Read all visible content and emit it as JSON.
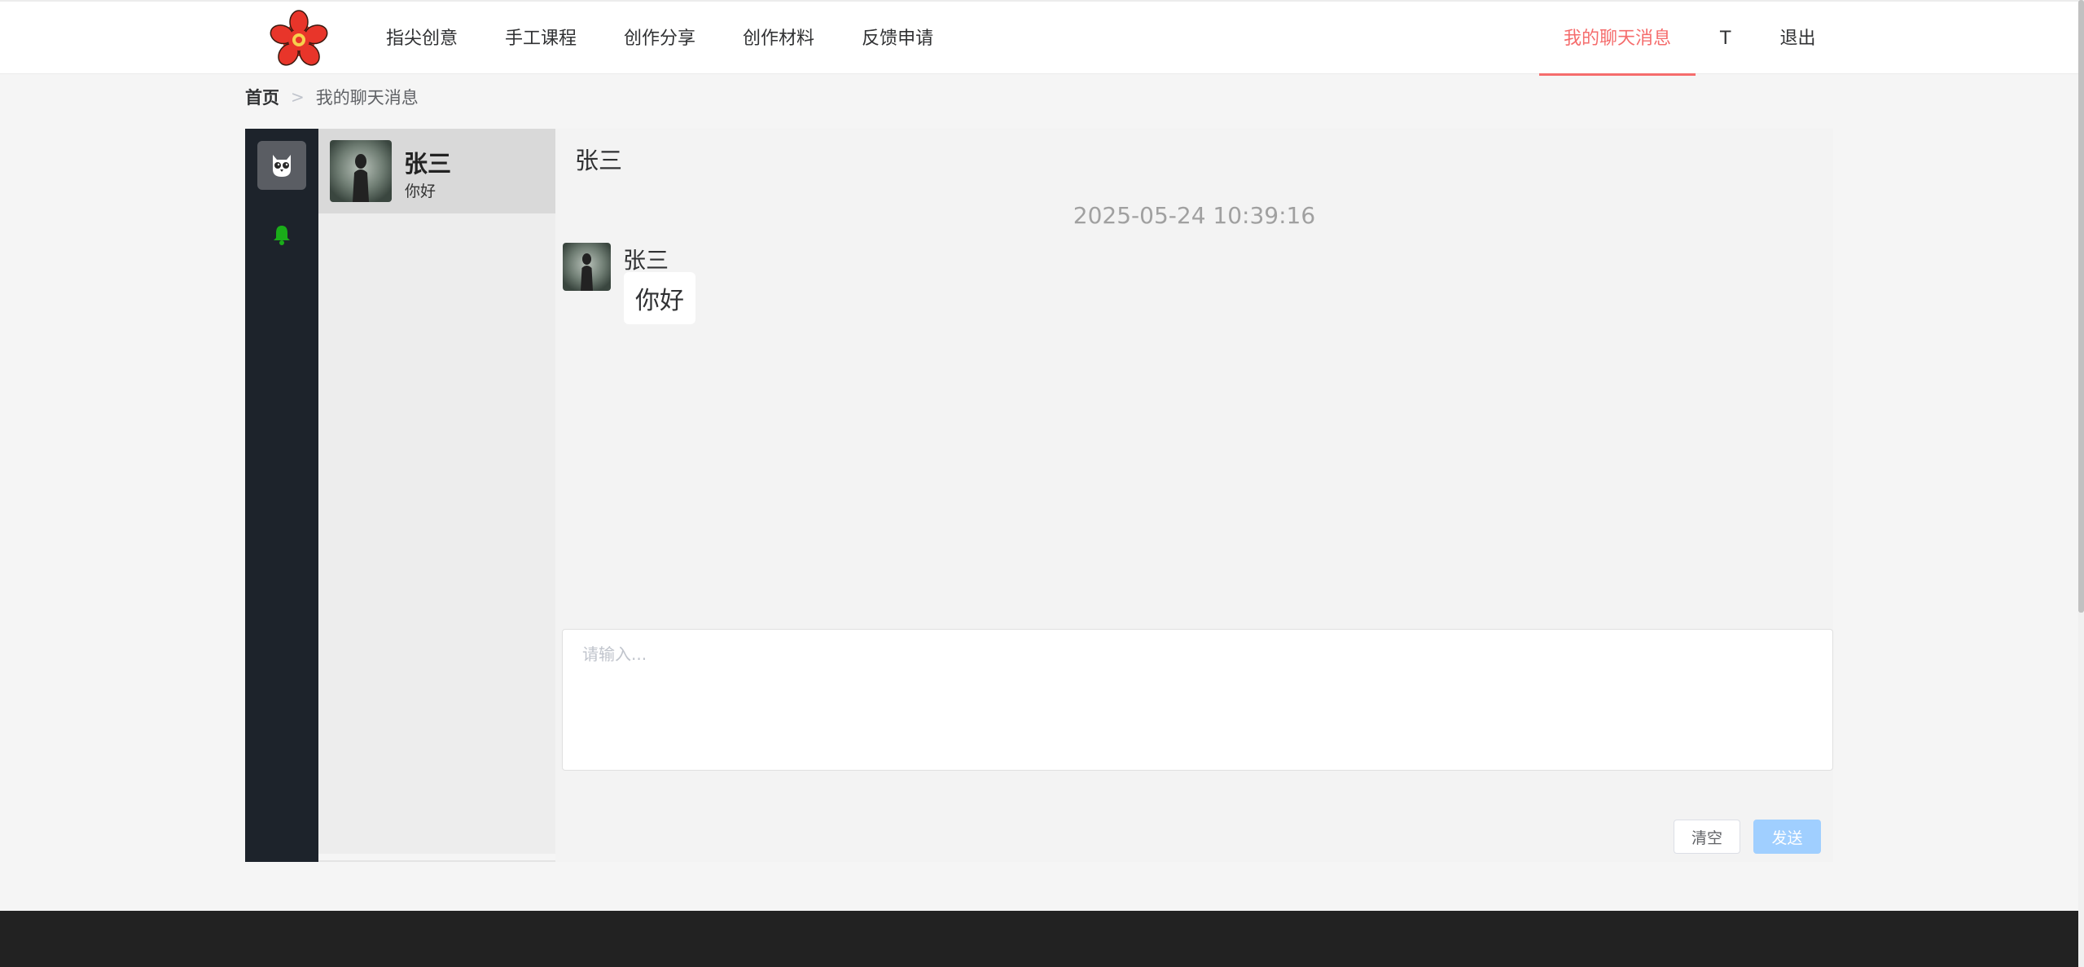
{
  "header": {
    "nav": [
      "指尖创意",
      "手工课程",
      "创作分享",
      "创作材料",
      "反馈申请"
    ],
    "right_nav": {
      "messages": "我的聊天消息",
      "user": "T",
      "logout": "退出"
    }
  },
  "breadcrumb": {
    "home": "首页",
    "separator": ">",
    "current": "我的聊天消息"
  },
  "contacts": [
    {
      "name": "张三",
      "last_message": "你好"
    }
  ],
  "chat": {
    "title": "张三",
    "messages": [
      {
        "time": "2025-05-24 10:39:16",
        "sender": "张三",
        "text": "你好"
      }
    ],
    "input_placeholder": "请输入...",
    "clear_label": "清空",
    "send_label": "发送"
  },
  "footer": {
    "columns": [
      "",
      "",
      "",
      ""
    ]
  },
  "colors": {
    "accent": "#f56c6c",
    "sidebar_bg": "#1d232b",
    "send_button": "#a0cfff",
    "bell_icon": "#1aad19",
    "footer_bg": "#222222"
  }
}
